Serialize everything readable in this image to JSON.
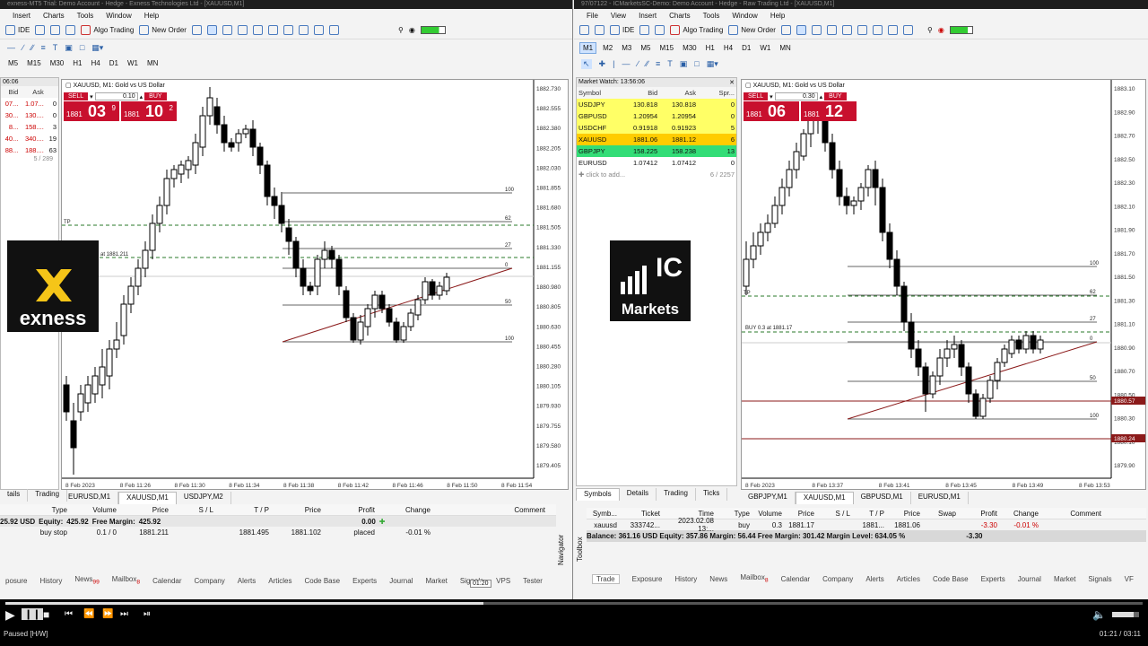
{
  "left": {
    "title": "exness-MT5 Trial: Demo Account - Hedge - Exness Technologies Ltd - [XAUUSD,M1]",
    "menu": [
      "Insert",
      "Charts",
      "Tools",
      "Window",
      "Help"
    ],
    "toolbar": {
      "ide": "IDE",
      "algo": "Algo Trading",
      "new_order": "New Order"
    },
    "timeframes": [
      "M5",
      "M15",
      "M30",
      "H1",
      "H4",
      "D1",
      "W1",
      "MN"
    ],
    "mw_header": "06:06",
    "mw_cols": [
      "Bid",
      "Ask",
      ""
    ],
    "mw_rows": [
      {
        "bid": "07...",
        "ask": "1.07...",
        "sp": "0",
        "color": "#ffffff"
      },
      {
        "bid": "30...",
        "ask": "130....",
        "sp": "0",
        "color": "#ffffff"
      },
      {
        "bid": "8...",
        "ask": "158....",
        "sp": "3",
        "color": "#ffffff"
      },
      {
        "bid": "40...",
        "ask": "340....",
        "sp": "19",
        "color": "#ffffff"
      },
      {
        "bid": "88...",
        "ask": "188....",
        "sp": "63",
        "color": "#ffffff"
      }
    ],
    "mw_count": "5 / 289",
    "chart_symbol": "XAUUSD, M1:  Gold vs US Dollar",
    "sell": "SELL",
    "buy": "BUY",
    "lot": "0.10",
    "bid_small": "1881",
    "bid_big": "03",
    "bid_sup": "9",
    "ask_small": "1881",
    "ask_big": "10",
    "ask_sup": "2",
    "tp_label": "TP",
    "order_label": "1 at 1881.211",
    "price_axis": [
      "1882.730",
      "1882.555",
      "1882.380",
      "1882.205",
      "1882.030",
      "1881.855",
      "1881.680",
      "1881.505",
      "1881.330",
      "1881.155",
      "1880.980",
      "1880.805",
      "1880.630",
      "1880.455",
      "1880.280",
      "1880.105",
      "1879.930",
      "1879.755",
      "1879.580",
      "1879.405"
    ],
    "time_axis": [
      "8 Feb 2023",
      "8 Feb 11:26",
      "8 Feb 11:30",
      "8 Feb 11:34",
      "8 Feb 11:38",
      "8 Feb 11:42",
      "8 Feb 11:46",
      "8 Feb 11:50",
      "8 Feb 11:54"
    ],
    "fib_levels": [
      "100",
      "62",
      "27",
      "0",
      "50",
      "100"
    ],
    "chart_tabs": [
      "EURUSD,M1",
      "XAUUSD,M1",
      "USDJPY,M2"
    ],
    "side_tabs": [
      "tails",
      "Trading"
    ],
    "trade_cols": [
      "Type",
      "Volume",
      "Price",
      "S / L",
      "T / P",
      "Price",
      "Profit",
      "Change",
      "Comment"
    ],
    "balance_line": {
      "balance": "25.92 USD",
      "equity_label": "Equity:",
      "equity": "425.92",
      "margin_label": "Free Margin:",
      "margin": "425.92",
      "profit": "0.00"
    },
    "order_row": {
      "type": "buy stop",
      "volume": "0.1 / 0",
      "price": "1881.211",
      "tp": "1881.495",
      "price2": "1881.102",
      "profit": "placed",
      "change": "-0.01 %"
    },
    "bottom_tabs": [
      "posure",
      "History",
      "News",
      "Mailbox",
      "Calendar",
      "Company",
      "Alerts",
      "Articles",
      "Code Base",
      "Experts",
      "Journal",
      "Market",
      "Signals",
      "VPS",
      "Tester"
    ],
    "news_badge": "99",
    "mailbox_badge": "8",
    "tooltip": "01:20",
    "navigator": "Navigator",
    "logo_text": "exness"
  },
  "right": {
    "title": "97/07122 - ICMarketsSC-Demo: Demo Account - Hedge - Raw Trading Ltd - [XAUUSD,M1]",
    "menu": [
      "File",
      "View",
      "Insert",
      "Charts",
      "Tools",
      "Window",
      "Help"
    ],
    "toolbar": {
      "ide": "IDE",
      "algo": "Algo Trading",
      "new_order": "New Order"
    },
    "timeframes": [
      "M1",
      "M2",
      "M3",
      "M5",
      "M15",
      "M30",
      "H1",
      "H4",
      "D1",
      "W1",
      "MN"
    ],
    "mw_header": "Market Watch: 13:56:06",
    "mw_cols": [
      "Symbol",
      "Bid",
      "Ask",
      "Spr..."
    ],
    "mw_rows": [
      {
        "sym": "USDJPY",
        "bid": "130.818",
        "ask": "130.818",
        "sp": "0",
        "color": "#ffff66"
      },
      {
        "sym": "GBPUSD",
        "bid": "1.20954",
        "ask": "1.20954",
        "sp": "0",
        "color": "#ffff66"
      },
      {
        "sym": "USDCHF",
        "bid": "0.91918",
        "ask": "0.91923",
        "sp": "5",
        "color": "#ffff66"
      },
      {
        "sym": "XAUUSD",
        "bid": "1881.06",
        "ask": "1881.12",
        "sp": "6",
        "color": "#ffcc00"
      },
      {
        "sym": "GBPJPY",
        "bid": "158.225",
        "ask": "158.238",
        "sp": "13",
        "color": "#33dd77"
      },
      {
        "sym": "EURUSD",
        "bid": "1.07412",
        "ask": "1.07412",
        "sp": "0",
        "color": "#ffffff"
      }
    ],
    "mw_add": "click to add...",
    "mw_count": "6 / 2257",
    "mw_tabs": [
      "Symbols",
      "Details",
      "Trading",
      "Ticks"
    ],
    "chart_symbol": "XAUUSD, M1:  Gold vs US Dollar",
    "sell": "SELL",
    "buy": "BUY",
    "lot": "0.30",
    "bid_small": "1881",
    "bid_big": "06",
    "ask_small": "1881",
    "ask_big": "12",
    "tp_label": "TP",
    "buy_label": "BUY 0.3 at 1881.17",
    "price_axis": [
      "1883.10",
      "1882.90",
      "1882.70",
      "1882.50",
      "1882.30",
      "1882.10",
      "1881.90",
      "1881.70",
      "1881.50",
      "1881.30",
      "1881.10",
      "1880.90",
      "1880.70",
      "1880.50",
      "1880.30",
      "1880.10",
      "1879.90"
    ],
    "price_tags": [
      "1880.57",
      "1880.24"
    ],
    "time_axis": [
      "8 Feb 2023",
      "8 Feb 13:37",
      "8 Feb 13:41",
      "8 Feb 13:45",
      "8 Feb 13:49",
      "8 Feb 13:53"
    ],
    "fib_levels": [
      "100",
      "62",
      "27",
      "0",
      "50",
      "100"
    ],
    "chart_tabs": [
      "GBPJPY,M1",
      "XAUUSD,M1",
      "GBPUSD,M1",
      "EURUSD,M1"
    ],
    "trade_cols": [
      "Symb...",
      "Ticket",
      "Time",
      "Type",
      "Volume",
      "Price",
      "S / L",
      "T / P",
      "Price",
      "Swap",
      "Profit",
      "Change",
      "Comment"
    ],
    "trade_row": {
      "sym": "xauusd",
      "ticket": "333742...",
      "time": "2023.02.08 13:...",
      "type": "buy",
      "volume": "0.3",
      "price": "1881.17",
      "sl": "",
      "tp": "1881...",
      "price2": "1881.06",
      "swap": "",
      "profit": "-3.30",
      "change": "-0.01 %"
    },
    "balance_line": "Balance: 361.16 USD  Equity: 357.86  Margin: 56.44  Free Margin: 301.42  Margin Level: 634.05 %",
    "balance_profit": "-3.30",
    "bottom_tabs": [
      "Trade",
      "Exposure",
      "History",
      "News",
      "Mailbox",
      "Calendar",
      "Company",
      "Alerts",
      "Articles",
      "Code Base",
      "Experts",
      "Journal",
      "Market",
      "Signals",
      "VF"
    ],
    "mailbox_badge": "8",
    "toolbox": "Toolbox",
    "logo_line1": "IC",
    "logo_line2": "Markets"
  },
  "player": {
    "status": "Paused [H/W]",
    "time": "01:21 / 03:11"
  }
}
